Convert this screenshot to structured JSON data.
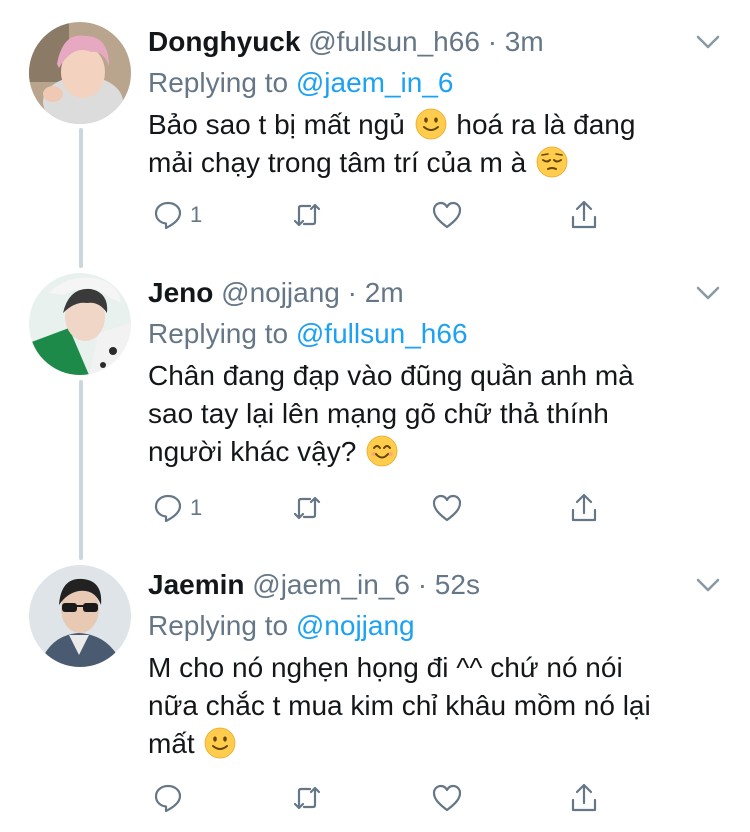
{
  "tweets": [
    {
      "name": "Donghyuck",
      "handle": "@fullsun_h66",
      "dot": "·",
      "time": "3m",
      "replying_prefix": "Replying to",
      "replying_to": "@jaem_in_6",
      "text_lines": [
        "Bảo sao t bị mất ngủ",
        "hoá ra là đang",
        "mải chạy trong tâm trí của m à"
      ],
      "reply_count": "1",
      "avatar_colors": {
        "bg": "#b9a58d",
        "hair": "#e7a9c2",
        "skin": "#f3d2bf",
        "shirt": "#d9d9d9"
      }
    },
    {
      "name": "Jeno",
      "handle": "@nojjang",
      "dot": "·",
      "time": "2m",
      "replying_prefix": "Replying to",
      "replying_to": "@fullsun_h66",
      "text_lines": [
        "Chân đang đạp vào đũng quần anh mà",
        "sao tay lại lên mạng gõ chữ thả thính",
        "người khác vậy?"
      ],
      "reply_count": "1",
      "avatar_colors": {
        "bg": "#e9f1ee",
        "hair": "#3a3a3a",
        "skin": "#efd6c6",
        "shirt": "#1e8a4a"
      }
    },
    {
      "name": "Jaemin",
      "handle": "@jaem_in_6",
      "dot": "·",
      "time": "52s",
      "replying_prefix": "Replying to",
      "replying_to": "@nojjang",
      "text_lines": [
        "M cho nó nghẹn họng đi ^^ chứ nó nói",
        "nữa chắc t mua kim chỉ khâu mồm nó lại",
        "mất"
      ],
      "reply_count": "",
      "avatar_colors": {
        "bg": "#dfe4e8",
        "hair": "#222222",
        "skin": "#e8c9b3",
        "shirt": "#4a5a70"
      }
    }
  ],
  "colors": {
    "name": "#14171a",
    "meta": "#657786",
    "link": "#1da1f2",
    "icon": "#657786",
    "thread": "#ccd6dd"
  },
  "icons": [
    "chevron-down-icon",
    "reply-icon",
    "retweet-icon",
    "like-icon",
    "share-icon",
    "slight-smile-emoji",
    "pensive-emoji",
    "smile-emoji"
  ]
}
